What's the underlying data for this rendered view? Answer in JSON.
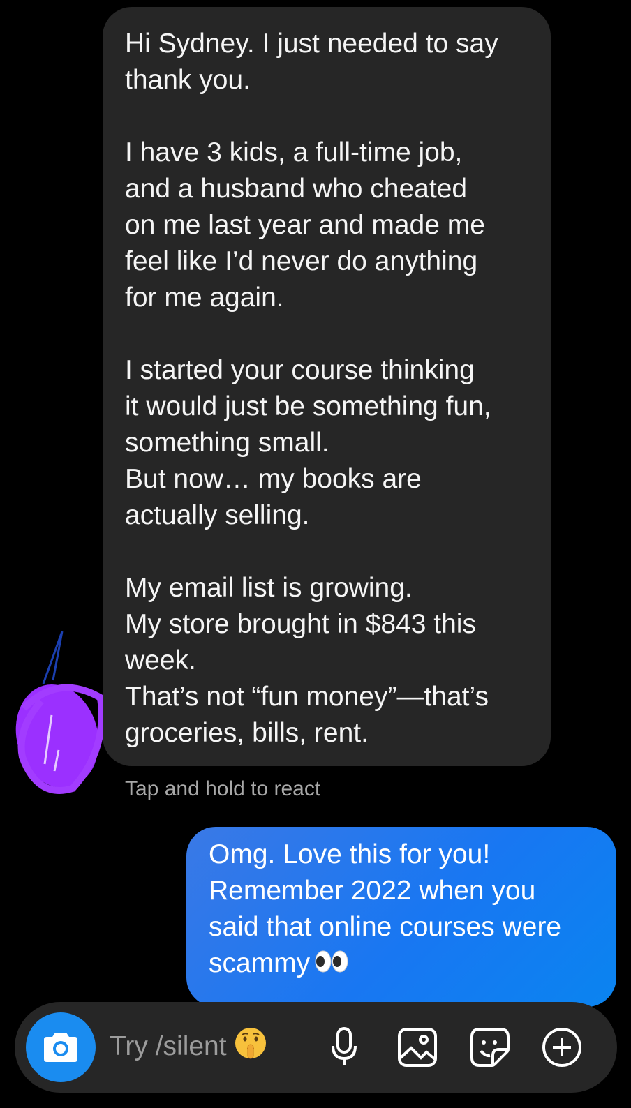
{
  "conversation": {
    "incoming_message": {
      "lines": [
        "Hi Sydney. I just needed to say",
        "thank you.",
        "",
        "I have 3 kids, a full-time job,",
        "and a husband who cheated",
        "on me last year and made me",
        "feel like I’d never do anything",
        "for me again.",
        "",
        "I started your course thinking",
        "it would just be something fun,",
        "something small.",
        "But now… my books are",
        "actually selling.",
        "",
        "My email list is growing.",
        "My store brought in $843 this",
        "week.",
        "That’s not “fun money”—that’s",
        "groceries, bills, rent."
      ]
    },
    "react_hint": "Tap and hold to react",
    "outgoing_message": {
      "lines": [
        "Omg. Love this for you!",
        "Remember 2022 when you",
        "said that online courses were",
        "scammy"
      ],
      "trailing_icon": "eyes-emoji"
    },
    "avatar_icon": "redacted-avatar-scribble"
  },
  "composer": {
    "camera_icon": "camera-icon",
    "placeholder": "Try /silent",
    "placeholder_emoji": "shushing-face-emoji",
    "icons": [
      "microphone-icon",
      "gallery-icon",
      "sticker-icon",
      "plus-icon"
    ]
  },
  "colors": {
    "background": "#000000",
    "incoming_bubble": "#262626",
    "outgoing_bubble": "#1877f2",
    "camera_button": "#1a8cf0",
    "hint_text": "#a8a8a8",
    "avatar_scribble": "#9b30ff"
  }
}
